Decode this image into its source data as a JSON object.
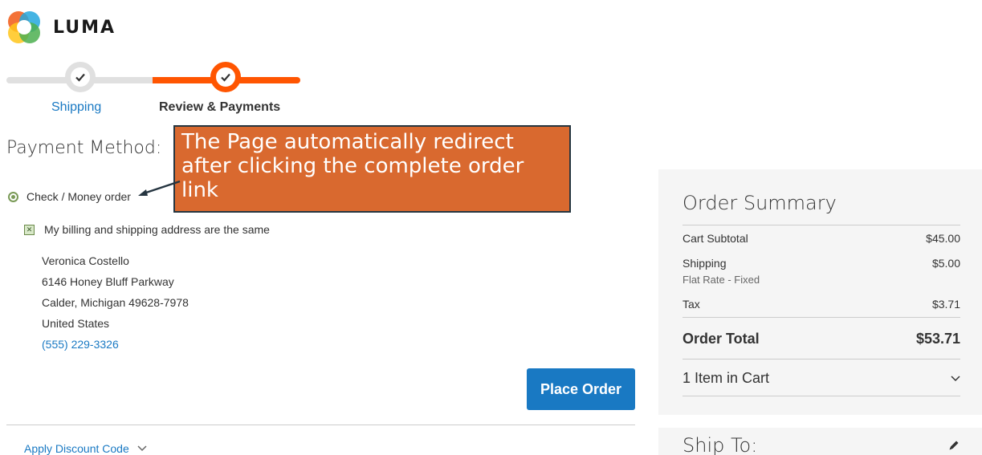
{
  "brand": {
    "name": "LUMA"
  },
  "progress": {
    "steps": [
      {
        "label": "Shipping",
        "state": "complete"
      },
      {
        "label": "Review & Payments",
        "state": "active"
      }
    ]
  },
  "payment": {
    "title": "Payment Method:",
    "method_label": "Check / Money order",
    "same_address_label": "My billing and shipping address are the same",
    "address": {
      "name": "Veronica Costello",
      "street": "6146 Honey Bluff Parkway",
      "city_line": "Calder, Michigan 49628-7978",
      "country": "United States",
      "phone": "(555) 229-3326"
    },
    "place_order_label": "Place Order"
  },
  "annotation": {
    "text": "The Page automatically redirect after clicking the complete order link"
  },
  "discount": {
    "label": "Apply Discount Code"
  },
  "summary": {
    "title": "Order Summary",
    "cart_subtotal_label": "Cart Subtotal",
    "cart_subtotal": "$45.00",
    "shipping_label": "Shipping",
    "shipping_method": "Flat Rate - Fixed",
    "shipping": "$5.00",
    "tax_label": "Tax",
    "tax": "$3.71",
    "total_label": "Order Total",
    "total": "$53.71",
    "items_label": "1 Item in Cart"
  },
  "ship_to": {
    "title": "Ship To:"
  },
  "colors": {
    "accent": "#ff5501",
    "link": "#1979c3",
    "annotation_bg": "#d9692f",
    "summary_bg": "#f5f5f5"
  }
}
